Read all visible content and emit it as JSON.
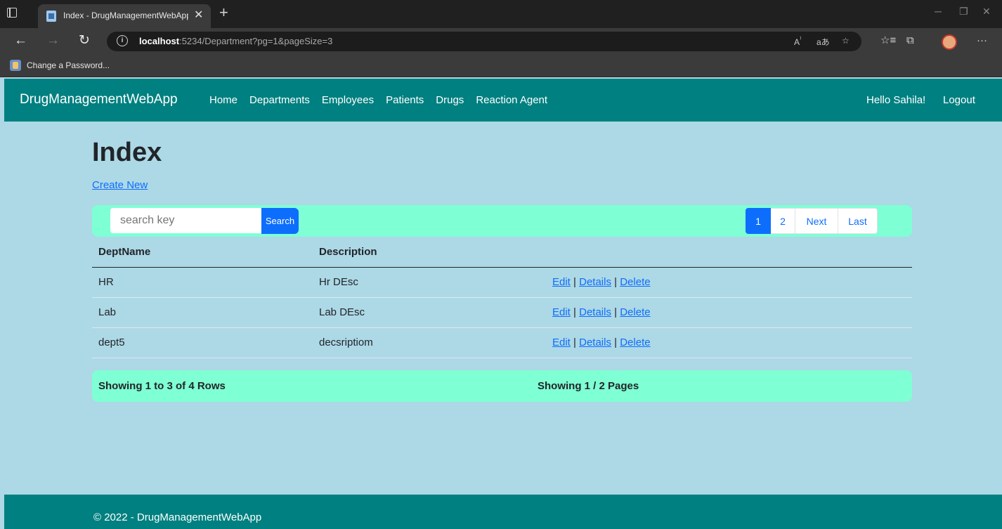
{
  "browser": {
    "tab_title": "Index - DrugManagementWebApp",
    "tab_close": "✕",
    "new_tab": "+",
    "url_host": "localhost",
    "url_rest": ":5234/Department?pg=1&pageSize=3",
    "favorite_label": "Change a Password..."
  },
  "app": {
    "brand": "DrugManagementWebApp",
    "nav": [
      "Home",
      "Departments",
      "Employees",
      "Patients",
      "Drugs",
      "Reaction Agent"
    ],
    "greeting": "Hello Sahila!",
    "logout": "Logout"
  },
  "page": {
    "title": "Index",
    "create_new": "Create New"
  },
  "search": {
    "placeholder": "search key",
    "button": "Search"
  },
  "pagination": {
    "items": [
      "1",
      "2",
      "Next",
      "Last"
    ],
    "active": "1"
  },
  "table": {
    "headers": [
      "DeptName",
      "Description",
      ""
    ],
    "rows": [
      {
        "name": "HR",
        "description": "Hr DEsc"
      },
      {
        "name": "Lab",
        "description": "Lab DEsc"
      },
      {
        "name": "dept5",
        "description": "decsriptiom"
      }
    ],
    "actions": {
      "edit": "Edit",
      "details": "Details",
      "delete": "Delete",
      "separator": "|"
    }
  },
  "summary": {
    "rows": "Showing 1 to 3 of 4 Rows",
    "pages": "Showing 1 / 2 Pages"
  },
  "footer": {
    "text": "© 2022 - DrugManagementWebApp"
  }
}
